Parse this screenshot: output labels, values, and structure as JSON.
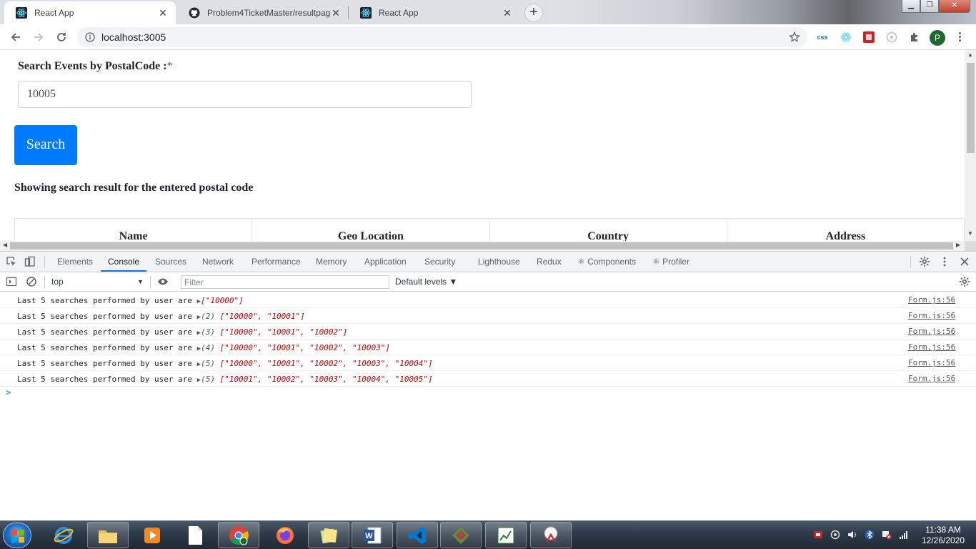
{
  "browser": {
    "tabs": [
      {
        "title": "React App",
        "active": true
      },
      {
        "title": "Problem4TicketMaster/resultpag",
        "active": false
      },
      {
        "title": "React App",
        "active": false
      }
    ],
    "url": "localhost:3005",
    "profile_initial": "P"
  },
  "page": {
    "label": "Search Events by PostalCode :",
    "required_mark": "*",
    "postal_value": "10005",
    "search_label": "Search",
    "result_text": "Showing search result for the entered postal code",
    "table_headers": [
      "Name",
      "Geo Location",
      "Country",
      "Address"
    ]
  },
  "devtools": {
    "tabs": [
      "Elements",
      "Console",
      "Sources",
      "Network",
      "Performance",
      "Memory",
      "Application",
      "Security",
      "Lighthouse",
      "Redux",
      "Components",
      "Profiler"
    ],
    "active_tab": "Console",
    "context": "top",
    "filter_placeholder": "Filter",
    "levels": "Default levels",
    "logs": [
      {
        "text": "Last 5 searches performed by user are",
        "count": "",
        "array": "[\"10000\"]",
        "source": "Form.js:56"
      },
      {
        "text": "Last 5 searches performed by user are",
        "count": "(2)",
        "array": "[\"10000\", \"10001\"]",
        "source": "Form.js:56"
      },
      {
        "text": "Last 5 searches performed by user are",
        "count": "(3)",
        "array": "[\"10000\", \"10001\", \"10002\"]",
        "source": "Form.js:56"
      },
      {
        "text": "Last 5 searches performed by user are",
        "count": "(4)",
        "array": "[\"10000\", \"10001\", \"10002\", \"10003\"]",
        "source": "Form.js:56"
      },
      {
        "text": "Last 5 searches performed by user are",
        "count": "(5)",
        "array": "[\"10000\", \"10001\", \"10002\", \"10003\", \"10004\"]",
        "source": "Form.js:56"
      },
      {
        "text": "Last 5 searches performed by user are",
        "count": "(5)",
        "array": "[\"10001\", \"10002\", \"10003\", \"10004\", \"10005\"]",
        "source": "Form.js:56"
      }
    ],
    "prompt": ">"
  },
  "taskbar": {
    "time": "11:38 AM",
    "date": "12/26/2020",
    "apps": [
      "internet-explorer",
      "file-explorer",
      "media-player",
      "notepad-doc",
      "chrome",
      "firefox",
      "sticky-notes",
      "word",
      "vscode",
      "git-gui",
      "excel-like",
      "snipping-tool"
    ]
  },
  "colors": {
    "primary": "#007bff",
    "required": "#dc3545",
    "devtools_accent": "#1a73e8",
    "log_array": "#c80000"
  }
}
